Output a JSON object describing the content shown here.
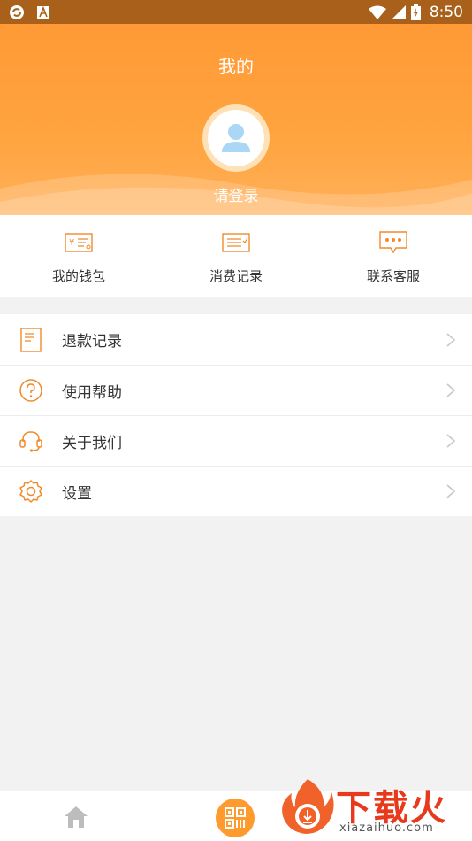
{
  "status_bar": {
    "time": "8:50",
    "icons": [
      "sync-icon",
      "a-icon",
      "wifi-icon",
      "signal-icon",
      "battery-charging-icon"
    ]
  },
  "header": {
    "title": "我的",
    "login_text": "请登录",
    "colors": {
      "primary": "#ff9a36",
      "accent": "#ffb05a"
    }
  },
  "quick_actions": [
    {
      "label": "我的钱包",
      "icon": "wallet-icon"
    },
    {
      "label": "消费记录",
      "icon": "receipt-icon"
    },
    {
      "label": "联系客服",
      "icon": "chat-icon"
    }
  ],
  "menu": [
    {
      "label": "退款记录",
      "icon": "document-icon"
    },
    {
      "label": "使用帮助",
      "icon": "help-icon"
    },
    {
      "label": "关于我们",
      "icon": "headset-icon"
    },
    {
      "label": "设置",
      "icon": "gear-icon"
    }
  ],
  "bottom_nav": {
    "items": [
      {
        "icon": "home-icon"
      },
      {
        "icon": "qr-scan-icon"
      }
    ]
  },
  "watermark": {
    "brand": "下载火",
    "url": "xiazaihuo.com"
  }
}
